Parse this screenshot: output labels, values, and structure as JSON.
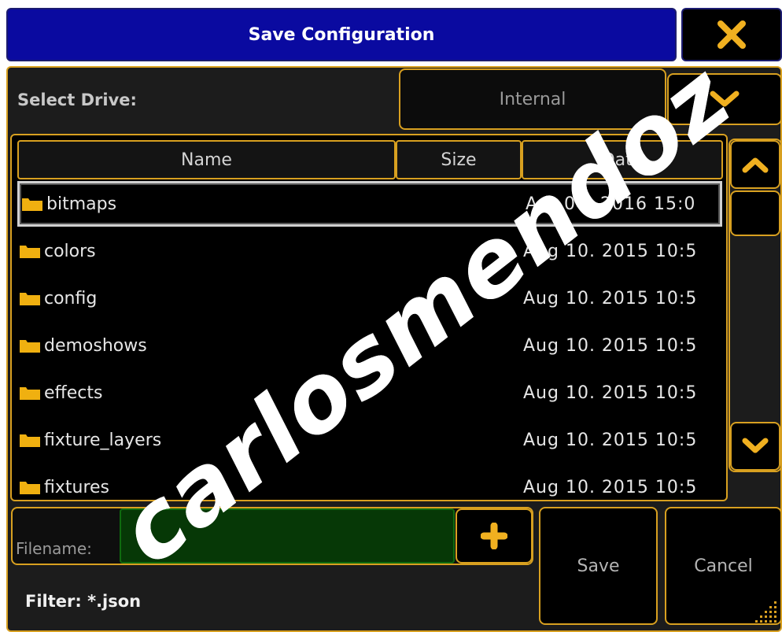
{
  "dialog": {
    "title": "Save Configuration",
    "close_icon": "close-x-icon"
  },
  "drive": {
    "label": "Select Drive:",
    "selected": "Internal",
    "dropdown_icon": "chevron-down-icon"
  },
  "table": {
    "columns": [
      "Name",
      "Size",
      "Date"
    ],
    "rows": [
      {
        "name": "bitmaps",
        "size": "",
        "date": "Apr 04. 2016 15:0",
        "selected": true
      },
      {
        "name": "colors",
        "size": "",
        "date": "Aug 10. 2015 10:5"
      },
      {
        "name": "config",
        "size": "",
        "date": "Aug 10. 2015 10:5"
      },
      {
        "name": "demoshows",
        "size": "",
        "date": "Aug 10. 2015 10:5"
      },
      {
        "name": "effects",
        "size": "",
        "date": "Aug 10. 2015 10:5"
      },
      {
        "name": "fixture_layers",
        "size": "",
        "date": "Aug 10. 2015 10:5"
      },
      {
        "name": "fixtures",
        "size": "",
        "date": "Aug 10. 2015 10:5"
      }
    ]
  },
  "filename": {
    "label": "Filename:",
    "value": "",
    "add_icon": "plus-icon"
  },
  "filter": {
    "text": "Filter: *.json"
  },
  "buttons": {
    "save": "Save",
    "cancel": "Cancel"
  },
  "watermark": {
    "text": "carlosmendoz"
  },
  "colors": {
    "accent": "#d8a020",
    "title_bg": "#0a0aa0",
    "panel_bg": "#1c1c1c",
    "input_bg": "#063806",
    "folder": "#f0b010"
  }
}
